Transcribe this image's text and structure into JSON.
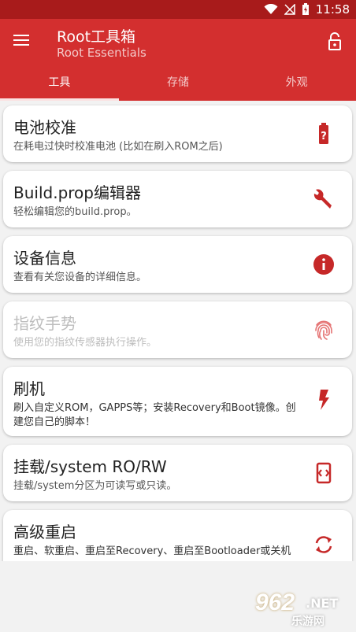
{
  "status_bar": {
    "time": "11:58"
  },
  "header": {
    "title": "Root工具箱",
    "subtitle": "Root Essentials"
  },
  "tabs": [
    {
      "label": "工具",
      "active": true
    },
    {
      "label": "存储",
      "active": false
    },
    {
      "label": "外观",
      "active": false
    }
  ],
  "cards": [
    {
      "title": "电池校准",
      "desc": "在耗电过快时校准电池 (比如在刷入ROM之后)",
      "icon": "battery-alert-icon",
      "enabled": true
    },
    {
      "title": "Build.prop编辑器",
      "desc": "轻松编辑您的build.prop。",
      "icon": "wrench-icon",
      "enabled": true
    },
    {
      "title": "设备信息",
      "desc": "查看有关您设备的详细信息。",
      "icon": "info-icon",
      "enabled": true
    },
    {
      "title": "指纹手势",
      "desc": "使用您的指纹传感器执行操作。",
      "icon": "fingerprint-icon",
      "enabled": false
    },
    {
      "title": "刷机",
      "desc": "刷入自定义ROM，GAPPS等；安装Recovery和Boot镜像。创建您自己的脚本！",
      "icon": "flash-icon",
      "enabled": true
    },
    {
      "title": "挂载/system RO/RW",
      "desc": "挂载/system分区为可读写或只读。",
      "icon": "mount-icon",
      "enabled": true
    },
    {
      "title": "高级重启",
      "desc": "重启、软重启、重启至Recovery、重启至Bootloader或关机",
      "icon": "restart-icon",
      "enabled": true
    }
  ],
  "colors": {
    "primary": "#d32f2f",
    "status": "#a81b1b",
    "icon": "#c62828"
  },
  "watermark": {
    "big": "962",
    "net": ".NET",
    "small": "乐游网"
  }
}
